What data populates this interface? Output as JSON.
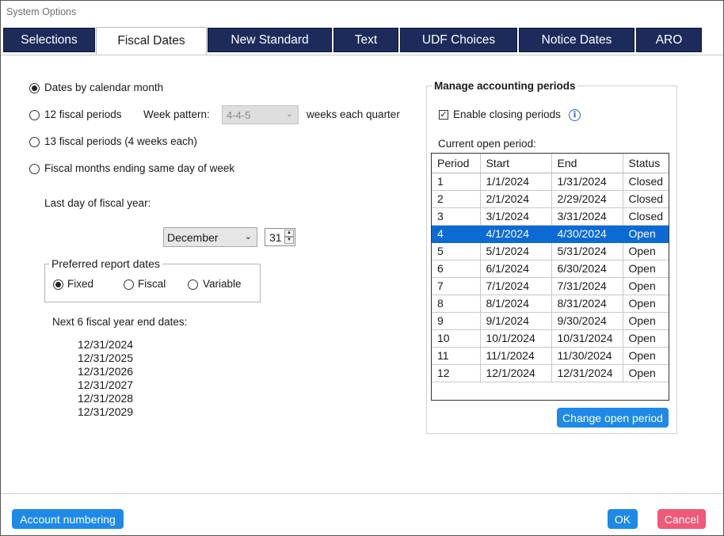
{
  "window": {
    "title": "System Options"
  },
  "tabs": [
    "Selections",
    "Fiscal Dates",
    "New Standard",
    "Text",
    "UDF Choices",
    "Notice Dates",
    "ARO"
  ],
  "active_tab": "Fiscal Dates",
  "fiscal_options": {
    "calendar_month": "Dates by calendar month",
    "twelve_periods": "12 fiscal periods",
    "week_pattern_label": "Week pattern:",
    "week_pattern_value": "4-4-5",
    "weeks_each_quarter": "weeks each quarter",
    "thirteen_periods": "13 fiscal periods (4 weeks each)",
    "same_day_of_week": "Fiscal months ending same day of week",
    "selected": "calendar_month"
  },
  "last_day": {
    "label": "Last day of fiscal year:",
    "month": "December",
    "day": "31"
  },
  "report_dates": {
    "legend": "Preferred report dates",
    "options": [
      "Fixed",
      "Fiscal",
      "Variable"
    ],
    "selected": "Fixed"
  },
  "next_dates": {
    "label": "Next 6 fiscal year end dates:",
    "dates": [
      "12/31/2024",
      "12/31/2025",
      "12/31/2026",
      "12/31/2027",
      "12/31/2028",
      "12/31/2029"
    ]
  },
  "accounting": {
    "heading": "Manage accounting periods",
    "enable_closing": "Enable closing periods",
    "enable_checked": true,
    "info_icon": "i",
    "current_label": "Current open period:",
    "columns": [
      "Period",
      "Start",
      "End",
      "Status"
    ],
    "rows": [
      [
        "1",
        "1/1/2024",
        "1/31/2024",
        "Closed"
      ],
      [
        "2",
        "2/1/2024",
        "2/29/2024",
        "Closed"
      ],
      [
        "3",
        "3/1/2024",
        "3/31/2024",
        "Closed"
      ],
      [
        "4",
        "4/1/2024",
        "4/30/2024",
        "Open"
      ],
      [
        "5",
        "5/1/2024",
        "5/31/2024",
        "Open"
      ],
      [
        "6",
        "6/1/2024",
        "6/30/2024",
        "Open"
      ],
      [
        "7",
        "7/1/2024",
        "7/31/2024",
        "Open"
      ],
      [
        "8",
        "8/1/2024",
        "8/31/2024",
        "Open"
      ],
      [
        "9",
        "9/1/2024",
        "9/30/2024",
        "Open"
      ],
      [
        "10",
        "10/1/2024",
        "10/31/2024",
        "Open"
      ],
      [
        "11",
        "11/1/2024",
        "11/30/2024",
        "Open"
      ],
      [
        "12",
        "12/1/2024",
        "12/31/2024",
        "Open"
      ]
    ],
    "selected_period": "4",
    "change_button": "Change open period"
  },
  "footer": {
    "account_numbering": "Account numbering",
    "ok": "OK",
    "cancel": "Cancel"
  },
  "colors": {
    "tab_bg": "#1c2b5a",
    "button_blue": "#1e8ae6",
    "button_cancel": "#ee5a78",
    "selection": "#0c6ad4"
  }
}
